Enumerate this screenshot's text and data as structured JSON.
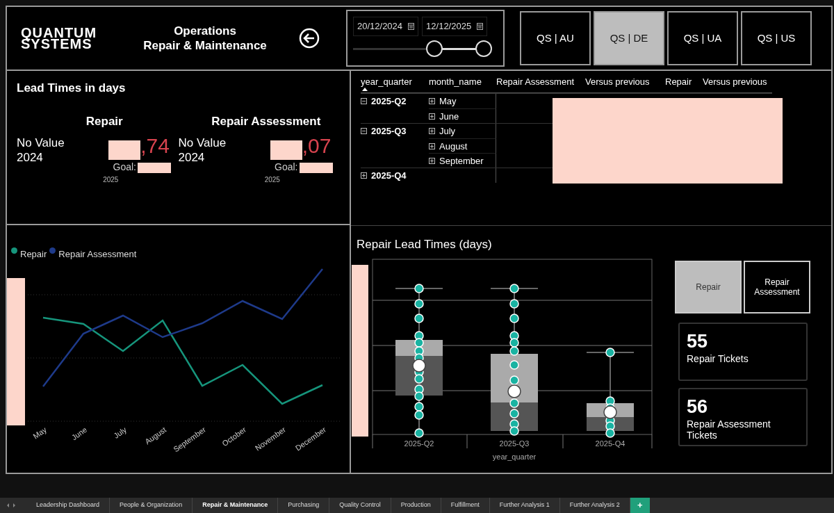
{
  "header": {
    "logo_lines": [
      "QUANTUM",
      "SYSTEMS"
    ],
    "title_lines": [
      "Operations",
      "Repair & Maintenance"
    ]
  },
  "date_range": {
    "start": "20/12/2024",
    "end": "12/12/2025",
    "handles": [
      {
        "level": 0.62
      },
      {
        "level": 1
      }
    ]
  },
  "regions": [
    {
      "label": "QS | AU",
      "selected": false
    },
    {
      "label": "QS | DE",
      "selected": true
    },
    {
      "label": "QS | UA",
      "selected": false
    },
    {
      "label": "QS | US",
      "selected": false
    }
  ],
  "lead_times": {
    "title": "Lead Times in days",
    "kpis": [
      {
        "heading": "Repair",
        "baseline": "No Value",
        "baseline_year": "2024",
        "value": ",74",
        "goal_label": "Goal:",
        "year": "2025"
      },
      {
        "heading": "Repair Assessment",
        "baseline": "No Value",
        "baseline_year": "2024",
        "value": ",07",
        "goal_label": "Goal:",
        "year": "2025"
      }
    ]
  },
  "trend_chart": {
    "legend": [
      {
        "name": "Repair",
        "color": "#16957c"
      },
      {
        "name": "Repair Assessment",
        "color": "#1e3a8a"
      }
    ],
    "x_labels": [
      "May",
      "June",
      "July",
      "August",
      "September",
      "October",
      "November",
      "December"
    ]
  },
  "matrix": {
    "columns": [
      {
        "label": "year_quarter",
        "sorted": true
      },
      {
        "label": "month_name",
        "sorted": false
      },
      {
        "label": "Repair Assessment",
        "sorted": false
      },
      {
        "label": "Versus previous",
        "sorted": false
      },
      {
        "label": "Repair",
        "sorted": false
      },
      {
        "label": "Versus previous",
        "sorted": false
      }
    ],
    "rows": [
      {
        "quarter": "2025-Q2",
        "expanded": true,
        "children": [
          {
            "month": "May",
            "expanded": false
          },
          {
            "month": "June",
            "expanded": false
          }
        ]
      },
      {
        "quarter": "2025-Q3",
        "expanded": true,
        "children": [
          {
            "month": "July",
            "expanded": false
          },
          {
            "month": "August",
            "expanded": false
          },
          {
            "month": "September",
            "expanded": false
          }
        ]
      },
      {
        "quarter": "2025-Q4",
        "expanded": false
      }
    ]
  },
  "boxplot": {
    "title": "Repair Lead Times (days)",
    "x_labels": [
      "2025-Q2",
      "2025-Q3",
      "2025-Q4"
    ],
    "axis_title": "year_quarter"
  },
  "measure_toggle": [
    {
      "label": "Repair",
      "selected": true
    },
    {
      "label": "Repair Assessment",
      "selected": false
    }
  ],
  "cards": [
    {
      "value": "55",
      "label": "Repair Tickets"
    },
    {
      "value": "56",
      "label": "Repair Assessment Tickets"
    }
  ],
  "sheet_tabs": [
    {
      "label": "Leadership Dashboard",
      "selected": false
    },
    {
      "label": "People & Organization",
      "selected": false
    },
    {
      "label": "Repair & Maintenance",
      "selected": true
    },
    {
      "label": "Purchasing",
      "selected": false
    },
    {
      "label": "Quality Control",
      "selected": false
    },
    {
      "label": "Production",
      "selected": false
    },
    {
      "label": "Fulfillment",
      "selected": false
    },
    {
      "label": "Further Analysis 1",
      "selected": false
    },
    {
      "label": "Further Analysis 2",
      "selected": false
    }
  ],
  "add_tab": "+"
}
